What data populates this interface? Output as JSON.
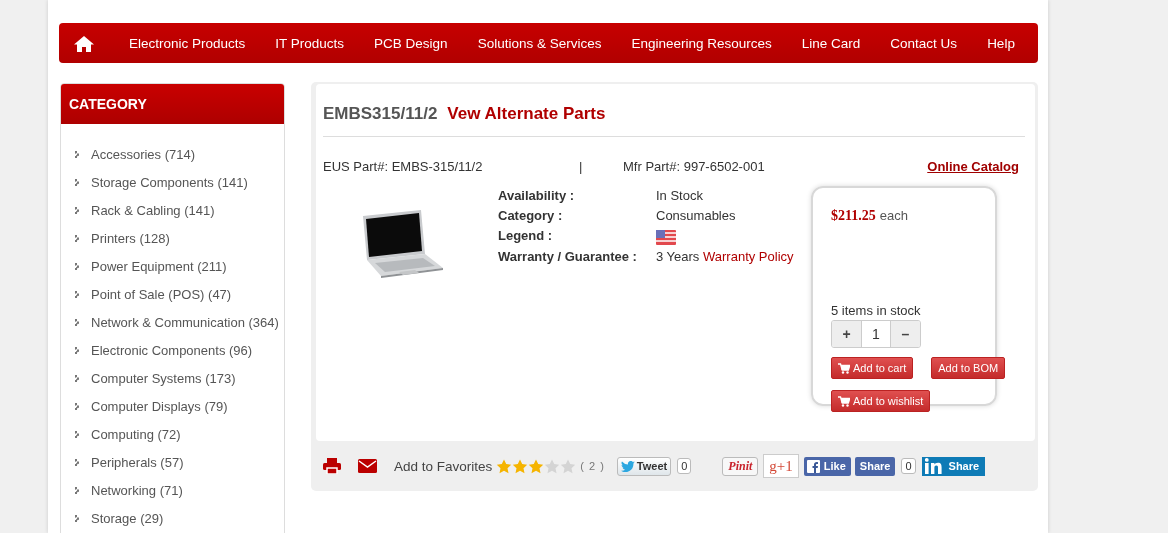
{
  "nav": {
    "items": [
      {
        "label": "Electronic Products"
      },
      {
        "label": "IT Products"
      },
      {
        "label": "PCB Design"
      },
      {
        "label": "Solutions & Services"
      },
      {
        "label": "Engineering Resources"
      },
      {
        "label": "Line Card"
      },
      {
        "label": "Contact Us"
      },
      {
        "label": "Help"
      }
    ]
  },
  "sidebar": {
    "title": "CATEGORY",
    "items": [
      {
        "label": "Accessories (714)"
      },
      {
        "label": "Storage Components (141)"
      },
      {
        "label": "Rack & Cabling (141)"
      },
      {
        "label": "Printers (128)"
      },
      {
        "label": "Power Equipment (211)"
      },
      {
        "label": "Point of Sale (POS) (47)"
      },
      {
        "label": "Network & Communication (364)"
      },
      {
        "label": "Electronic Components (96)"
      },
      {
        "label": "Computer Systems (173)"
      },
      {
        "label": "Computer Displays (79)"
      },
      {
        "label": "Computing (72)"
      },
      {
        "label": "Peripherals (57)"
      },
      {
        "label": "Networking (71)"
      },
      {
        "label": "Storage (29)"
      }
    ]
  },
  "product": {
    "part_title": "EMBS315/11/2",
    "alternate_link": "Vew Alternate Parts",
    "eus_part": "EUS Part#: EMBS-315/11/2",
    "separator": "|",
    "mfr_part": "Mfr Part#: 997-6502-001",
    "catalog_link": "Online Catalog",
    "specs": [
      {
        "kind": "text",
        "label": "Availability :",
        "value": "In Stock"
      },
      {
        "kind": "text",
        "label": "Category :",
        "value": "Consumables"
      },
      {
        "kind": "flag",
        "label": "Legend :"
      },
      {
        "kind": "warranty",
        "label": "Warranty / Guarantee :",
        "value": "3 Years",
        "link": "Warranty Policy"
      }
    ]
  },
  "purchase": {
    "price": "$211.25",
    "unit": "each",
    "stock": "5 items in stock",
    "increment": "+",
    "quantity": "1",
    "decrement": "–",
    "buttons": [
      {
        "label": "Add to cart",
        "kind": "cart"
      },
      {
        "label": "Add to BOM",
        "kind": "plain"
      },
      {
        "label": "Add to wishlist",
        "kind": "cart"
      }
    ]
  },
  "footer": {
    "favorites": "Add to Favorites",
    "stars": 3,
    "rating_count": "( 2 )",
    "tweet": "Tweet",
    "tweet_count": "0",
    "pinit": "Pinit",
    "gplus": "g+1",
    "like": "Like",
    "share": "Share",
    "share_count": "0",
    "linkedin": "Share"
  }
}
